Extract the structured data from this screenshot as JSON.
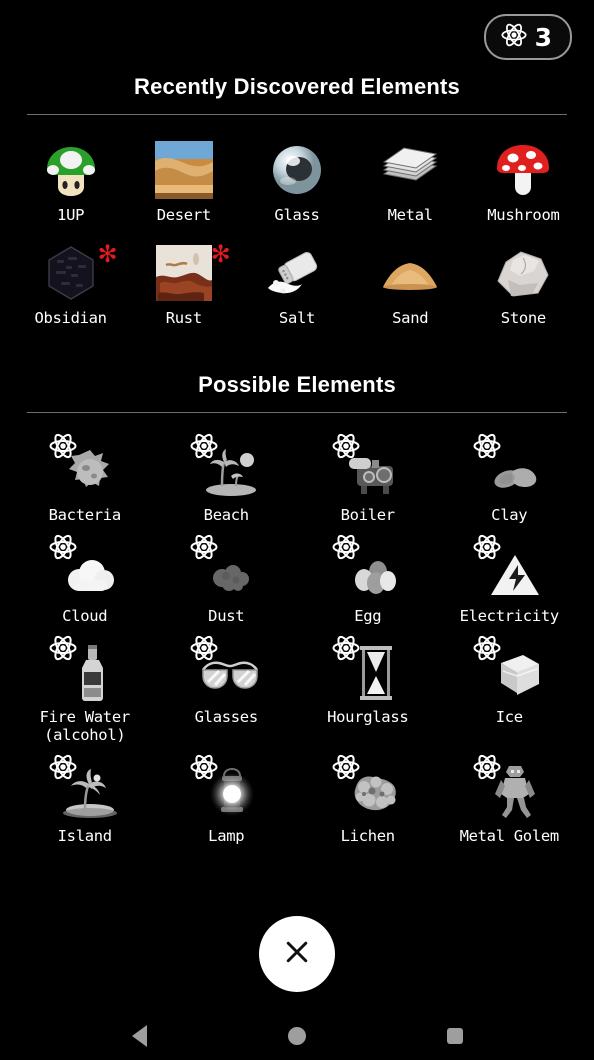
{
  "app": {
    "background_color": "#000000",
    "accent_star_color": "#e01b1b",
    "divider_color": "#6d6d6d"
  },
  "header": {
    "badge": {
      "icon": "atom-icon",
      "count": "3"
    }
  },
  "sections": [
    {
      "id": "recently-discovered",
      "title": "Recently Discovered Elements",
      "columns": 5,
      "items": [
        {
          "label": "1UP",
          "icon": "green-mushroom-icon",
          "new": false
        },
        {
          "label": "Desert",
          "icon": "desert-dunes-icon",
          "new": false
        },
        {
          "label": "Glass",
          "icon": "glass-orb-icon",
          "new": false
        },
        {
          "label": "Metal",
          "icon": "metal-sheets-icon",
          "new": false
        },
        {
          "label": "Mushroom",
          "icon": "red-mushroom-icon",
          "new": false
        },
        {
          "label": "Obsidian",
          "icon": "obsidian-block-icon",
          "new": true
        },
        {
          "label": "Rust",
          "icon": "rusted-metal-icon",
          "new": true
        },
        {
          "label": "Salt",
          "icon": "salt-shaker-icon",
          "new": false
        },
        {
          "label": "Sand",
          "icon": "sand-pile-icon",
          "new": false
        },
        {
          "label": "Stone",
          "icon": "stone-rock-icon",
          "new": false
        }
      ]
    },
    {
      "id": "possible-elements",
      "title": "Possible Elements",
      "columns": 4,
      "items": [
        {
          "label": "Bacteria",
          "icon": "bacteria-icon",
          "badge": "atom-icon"
        },
        {
          "label": "Beach",
          "icon": "beach-icon",
          "badge": "atom-icon"
        },
        {
          "label": "Boiler",
          "icon": "boiler-icon",
          "badge": "atom-icon"
        },
        {
          "label": "Clay",
          "icon": "clay-icon",
          "badge": "atom-icon"
        },
        {
          "label": "Cloud",
          "icon": "cloud-icon",
          "badge": "atom-icon"
        },
        {
          "label": "Dust",
          "icon": "dust-icon",
          "badge": "atom-icon"
        },
        {
          "label": "Egg",
          "icon": "egg-icon",
          "badge": "atom-icon"
        },
        {
          "label": "Electricity",
          "icon": "electricity-icon",
          "badge": "atom-icon"
        },
        {
          "label": "Fire Water\n(alcohol)",
          "icon": "fire-water-icon",
          "badge": "atom-icon"
        },
        {
          "label": "Glasses",
          "icon": "glasses-icon",
          "badge": "atom-icon"
        },
        {
          "label": "Hourglass",
          "icon": "hourglass-icon",
          "badge": "atom-icon"
        },
        {
          "label": "Ice",
          "icon": "ice-cube-icon",
          "badge": "atom-icon"
        },
        {
          "label": "Island",
          "icon": "island-icon",
          "badge": "atom-icon"
        },
        {
          "label": "Lamp",
          "icon": "lamp-icon",
          "badge": "atom-icon"
        },
        {
          "label": "Lichen",
          "icon": "lichen-icon",
          "badge": "atom-icon"
        },
        {
          "label": "Metal Golem",
          "icon": "metal-golem-icon",
          "badge": "atom-icon"
        }
      ]
    }
  ],
  "close_button": {
    "icon": "close-x-icon",
    "label": ""
  },
  "navbar": {
    "back": "back-triangle-icon",
    "home": "home-circle-icon",
    "recents": "recents-square-icon"
  },
  "star_glyph": "✻"
}
